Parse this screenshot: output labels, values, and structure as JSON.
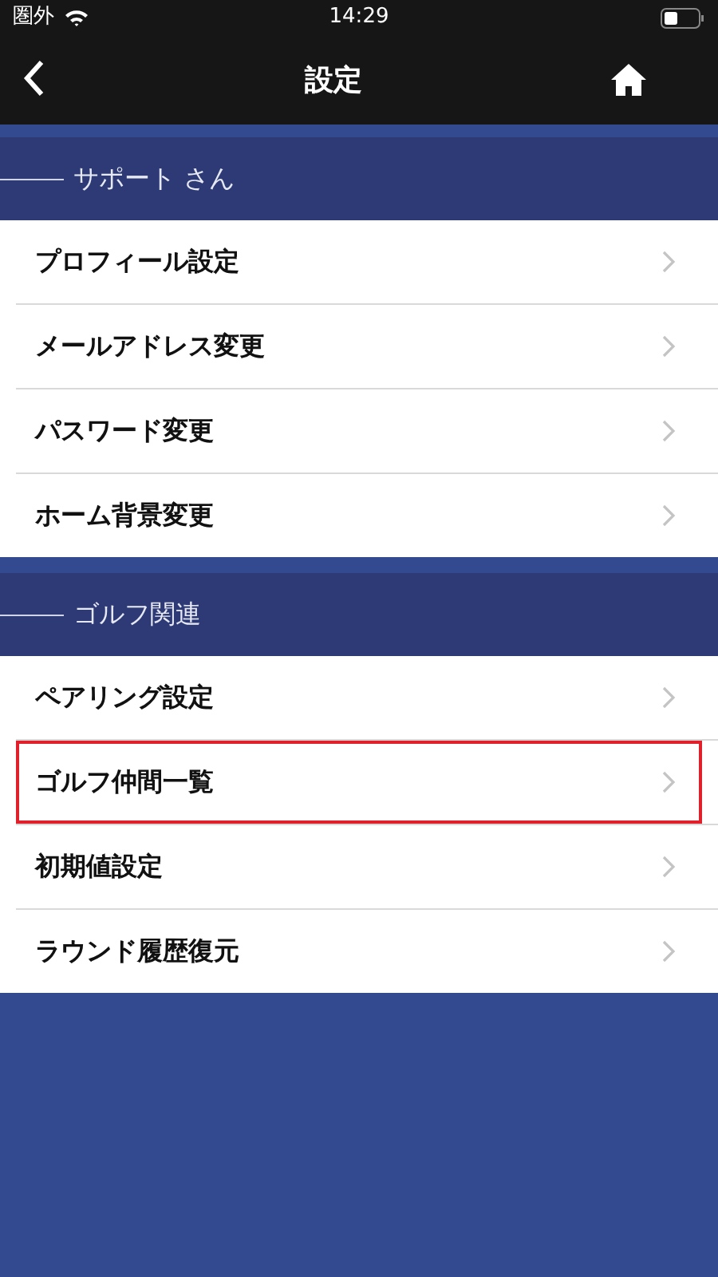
{
  "status_bar": {
    "carrier": "圏外",
    "time": "14:29"
  },
  "nav": {
    "title": "設定"
  },
  "sections": [
    {
      "title": "サポート さん",
      "items": [
        {
          "label": "プロフィール設定",
          "highlighted": false
        },
        {
          "label": "メールアドレス変更",
          "highlighted": false
        },
        {
          "label": "パスワード変更",
          "highlighted": false
        },
        {
          "label": "ホーム背景変更",
          "highlighted": false
        }
      ]
    },
    {
      "title": "ゴルフ関連",
      "items": [
        {
          "label": "ペアリング設定",
          "highlighted": false
        },
        {
          "label": "ゴルフ仲間一覧",
          "highlighted": true
        },
        {
          "label": "初期値設定",
          "highlighted": false
        },
        {
          "label": "ラウンド履歴復元",
          "highlighted": false
        }
      ]
    }
  ]
}
